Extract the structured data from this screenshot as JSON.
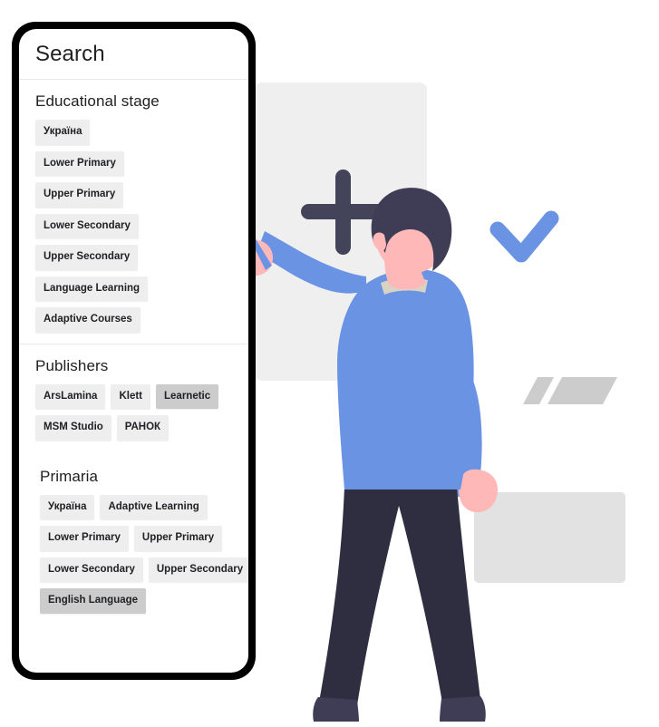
{
  "panel": {
    "title": "Search",
    "sections": [
      {
        "id": "educational-stage",
        "title": "Educational stage",
        "rows": [
          [
            {
              "label": "Україна",
              "selected": false
            }
          ],
          [
            {
              "label": "Lower Primary",
              "selected": false
            }
          ],
          [
            {
              "label": "Upper Primary",
              "selected": false
            }
          ],
          [
            {
              "label": "Lower Secondary",
              "selected": false
            }
          ],
          [
            {
              "label": "Upper Secondary",
              "selected": false
            }
          ],
          [
            {
              "label": "Language Learning",
              "selected": false
            }
          ],
          [
            {
              "label": "Adaptive Courses",
              "selected": false
            }
          ]
        ]
      },
      {
        "id": "publishers",
        "title": "Publishers",
        "rows": [
          [
            {
              "label": "ArsLamina",
              "selected": false
            },
            {
              "label": "Klett",
              "selected": false
            },
            {
              "label": "Learnetic",
              "selected": true
            }
          ],
          [
            {
              "label": "MSM Studio",
              "selected": false
            },
            {
              "label": "РАНОК",
              "selected": false
            }
          ]
        ]
      },
      {
        "id": "primaria",
        "title": "Primaria",
        "rows": [
          [
            {
              "label": "Україна",
              "selected": false
            },
            {
              "label": "Adaptive Learning",
              "selected": false
            }
          ],
          [
            {
              "label": "Lower Primary",
              "selected": false
            },
            {
              "label": "Upper Primary",
              "selected": false
            }
          ],
          [
            {
              "label": "Lower Secondary",
              "selected": false
            },
            {
              "label": "Upper Secondary",
              "selected": false
            }
          ],
          [
            {
              "label": "English Language",
              "selected": true
            }
          ]
        ]
      }
    ]
  },
  "illustration": {
    "whiteboard_label": "whiteboard",
    "plus_label": "plus-sign",
    "check_label": "check-mark",
    "colors": {
      "board": "#efefef",
      "plus": "#434359",
      "check": "#6a93e4",
      "shirt": "#6a93e4",
      "skin": "#ffb8b8",
      "hair": "#3f3d56",
      "trousers": "#2f2e41",
      "shoes": "#3f3d56",
      "collar": "#d9d3c4",
      "gray_shape": "#cccccc",
      "gray_box": "#e2e2e2",
      "pen": "#6a93e4",
      "frame": "#000000",
      "chip": "#eeeeee",
      "chip_selected": "#cccccc"
    }
  }
}
